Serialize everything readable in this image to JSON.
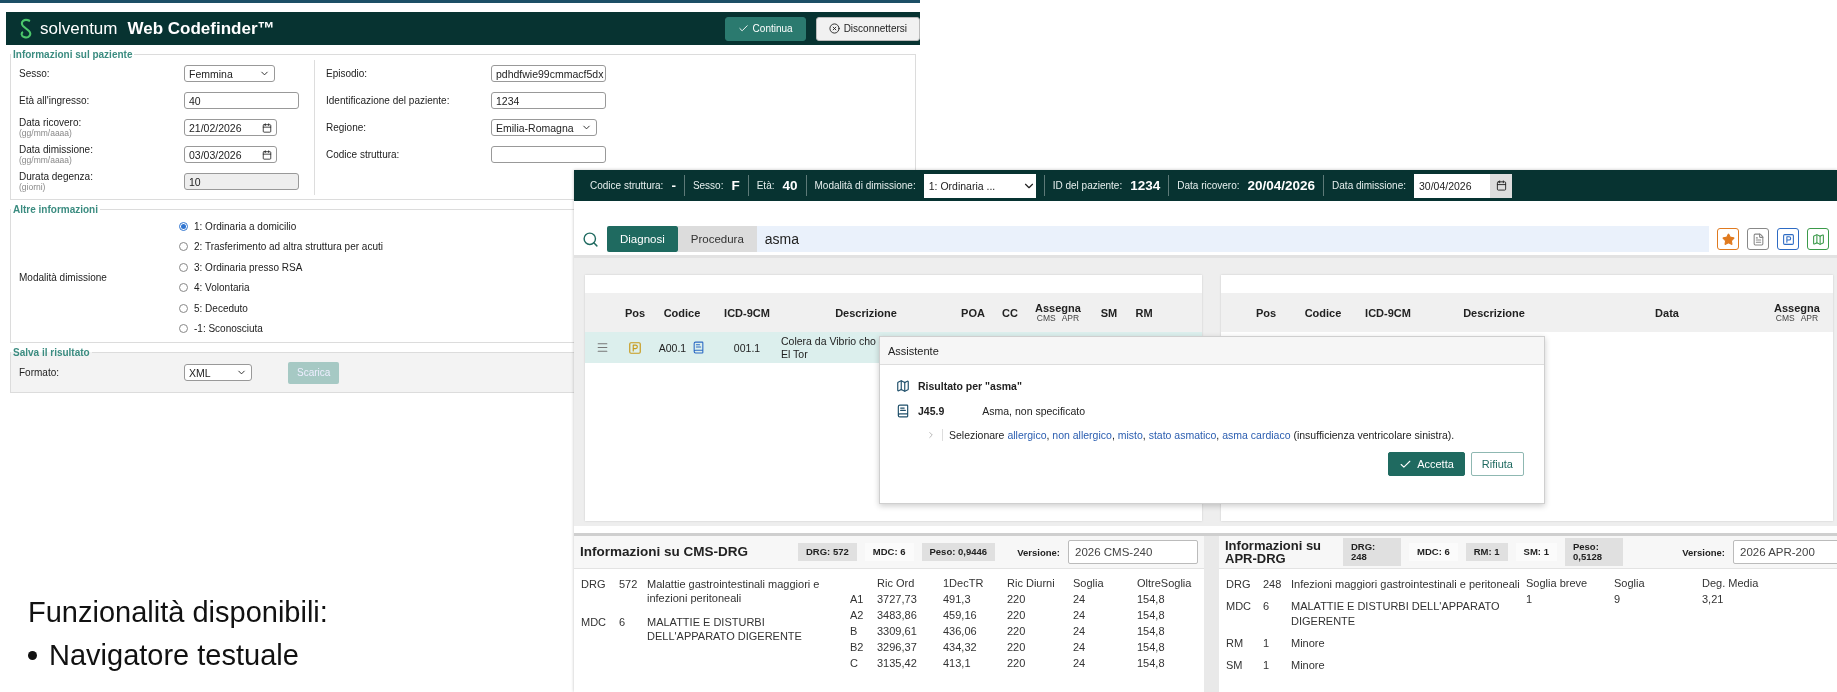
{
  "codefinder_window": {
    "brand": "solventum",
    "title": "Web Codefinder™",
    "buttons": [
      {
        "label": "Continua",
        "kind": "primary"
      },
      {
        "label": "Disconnettersi",
        "kind": "secondary"
      }
    ],
    "patient_section": {
      "title": "Informazioni sul paziente",
      "left_fields": [
        {
          "label": "Sesso:",
          "kind": "select",
          "value": "Femmina"
        },
        {
          "label": "Età all'ingresso:",
          "kind": "text",
          "value": "40"
        },
        {
          "label": "Data ricovero:",
          "hint": "(gg/mm/aaaa)",
          "kind": "date",
          "value": "21/02/2026"
        },
        {
          "label": "Data dimissione:",
          "hint": "(gg/mm/aaaa)",
          "kind": "date",
          "value": "03/03/2026"
        },
        {
          "label": "Durata degenza:",
          "hint": "(giorni)",
          "kind": "readonly",
          "value": "10"
        }
      ],
      "right_fields": [
        {
          "label": "Episodio:",
          "kind": "text",
          "value": "pdhdfwie99cmmacf5dx"
        },
        {
          "label": "Identificazione del paziente:",
          "kind": "text",
          "value": "1234"
        },
        {
          "label": "Regione:",
          "kind": "select",
          "value": "Emilia-Romagna"
        },
        {
          "label": "Codice struttura:",
          "kind": "text"
        }
      ]
    },
    "other_section": {
      "title": "Altre informazioni",
      "label": "Modalità dimissione",
      "options": [
        {
          "label": "1: Ordinaria a domicilio",
          "selected": true
        },
        {
          "label": "2: Trasferimento ad altra struttura per acuti",
          "selected": false
        },
        {
          "label": "3: Ordinaria presso RSA",
          "selected": false
        },
        {
          "label": "4: Volontaria",
          "selected": false
        },
        {
          "label": "5: Deceduto",
          "selected": false
        },
        {
          "label": "-1: Sconosciuta",
          "selected": false
        }
      ]
    },
    "save_section": {
      "title": "Salva il risultato",
      "label": "Formato:",
      "format": "XML",
      "button": {
        "label": "Scarica",
        "disabled": true
      }
    }
  },
  "coding_window": {
    "summary_bar": [
      {
        "label": "Codice struttura:",
        "kind": "value",
        "value": "-"
      },
      {
        "label": "Sesso:",
        "kind": "value",
        "value": "F"
      },
      {
        "label": "Età:",
        "kind": "value",
        "value": "40"
      },
      {
        "label": "Modalità di dimissione:",
        "kind": "select",
        "value": "1: Ordinaria ..."
      },
      {
        "label": "ID del paziente:",
        "kind": "value",
        "value": "1234"
      },
      {
        "label": "Data ricovero:",
        "kind": "value",
        "value": "20/04/2026"
      },
      {
        "label": "Data dimissione:",
        "kind": "date",
        "value": "30/04/2026"
      }
    ],
    "search": {
      "tabs": [
        {
          "label": "Diagnosi",
          "selected": true
        },
        {
          "label": "Procedura",
          "selected": false
        }
      ],
      "query": "asma"
    },
    "diagnosis_table": {
      "columns": [
        "Pos",
        "Codice",
        "ICD-9CM",
        "Descrizione",
        "POA",
        "CC",
        "Assegna",
        "SM",
        "RM"
      ],
      "assign_sub": [
        "CMS",
        "APR"
      ],
      "rows": [
        {
          "code": "A00.1",
          "icd9": "001.1",
          "description_lines": [
            "Colera da Vibrio cho",
            "El Tor"
          ],
          "selected": true
        }
      ]
    },
    "procedure_table": {
      "columns": [
        "Pos",
        "Codice",
        "ICD-9CM",
        "Descrizione",
        "Data",
        "Assegna"
      ],
      "assign_sub": [
        "CMS",
        "APR"
      ]
    },
    "assistant": {
      "title": "Assistente",
      "result_heading": "Risultato per \"asma\"",
      "code": "J45.9",
      "code_description": "Asma, non specificato",
      "note_parts": [
        {
          "text": "Selezionare ",
          "kind": "plain"
        },
        {
          "text": "allergico",
          "kind": "link"
        },
        {
          "text": ", ",
          "kind": "plain"
        },
        {
          "text": "non allergico",
          "kind": "link"
        },
        {
          "text": ", ",
          "kind": "plain"
        },
        {
          "text": "misto",
          "kind": "link"
        },
        {
          "text": ", ",
          "kind": "plain"
        },
        {
          "text": "stato asmatico",
          "kind": "link"
        },
        {
          "text": ", ",
          "kind": "plain"
        },
        {
          "text": "asma cardiaco",
          "kind": "link"
        },
        {
          "text": " (insufficienza ventricolare sinistra).",
          "kind": "plain"
        }
      ],
      "buttons": [
        {
          "label": "Accetta",
          "kind": "primary"
        },
        {
          "label": "Rifiuta",
          "kind": "secondary"
        }
      ]
    },
    "cms_drg": {
      "title": "Informazioni su CMS-DRG",
      "badges": [
        {
          "text": "DRG: 572",
          "shaded": true
        },
        {
          "text": "MDC: 6",
          "shaded": false
        },
        {
          "text": "Peso: 0,9446",
          "shaded": true
        }
      ],
      "version_label": "Versione:",
      "version": "2026 CMS-240",
      "info": [
        {
          "key": "DRG",
          "code": "572",
          "text": "Malattie gastrointestinali maggiori e infezioni peritoneali"
        },
        {
          "key": "MDC",
          "code": "6",
          "text": "MALATTIE E DISTURBI DELL'APPARATO DIGERENTE"
        }
      ],
      "columns": [
        "Ric Ord",
        "1DecTR",
        "Ric Diurni",
        "Soglia",
        "OltreSoglia"
      ],
      "rows": [
        {
          "class": "A1",
          "values": [
            "3727,73",
            "491,3",
            "220",
            "24",
            "154,8"
          ]
        },
        {
          "class": "A2",
          "values": [
            "3483,86",
            "459,16",
            "220",
            "24",
            "154,8"
          ]
        },
        {
          "class": "B",
          "values": [
            "3309,61",
            "436,06",
            "220",
            "24",
            "154,8"
          ]
        },
        {
          "class": "B2",
          "values": [
            "3296,37",
            "434,32",
            "220",
            "24",
            "154,8"
          ]
        },
        {
          "class": "C",
          "values": [
            "3135,42",
            "413,1",
            "220",
            "24",
            "154,8"
          ]
        }
      ]
    },
    "apr_drg": {
      "title": "Informazioni su APR-DRG",
      "badges": [
        {
          "text": "DRG: 248",
          "shaded": true
        },
        {
          "text": "MDC: 6",
          "shaded": false
        },
        {
          "text": "RM: 1",
          "shaded": true
        },
        {
          "text": "SM: 1",
          "shaded": false
        },
        {
          "text": "Peso: 0,5128",
          "shaded": true
        }
      ],
      "version_label": "Versione:",
      "version": "2026 APR-200",
      "info": [
        {
          "key": "DRG",
          "code": "248",
          "text": "Infezioni maggiori gastrointestinali e peritoneali"
        },
        {
          "key": "MDC",
          "code": "6",
          "text": "MALATTIE E DISTURBI DELL'APPARATO DIGERENTE"
        },
        {
          "key": "RM",
          "code": "1",
          "text": "Minore"
        },
        {
          "key": "SM",
          "code": "1",
          "text": "Minore"
        }
      ],
      "columns": [
        "Soglia breve",
        "Soglia",
        "Deg. Media"
      ],
      "values": [
        "1",
        "9",
        "3,21"
      ]
    }
  },
  "slide": {
    "heading": "Funzionalità disponibili:",
    "bullets": [
      "Navigatore testuale"
    ]
  }
}
